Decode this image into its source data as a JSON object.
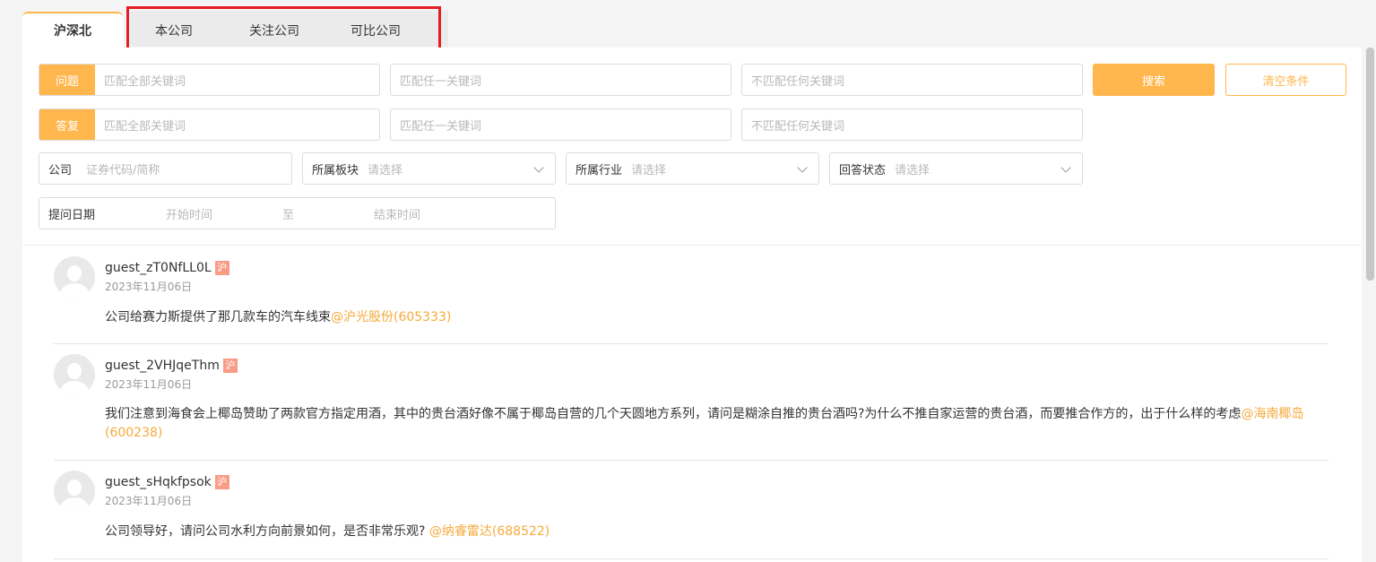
{
  "tabs": {
    "active": "沪深北",
    "group": [
      "本公司",
      "关注公司",
      "可比公司"
    ]
  },
  "search": {
    "question_tag": "问题",
    "answer_tag": "答复",
    "match_all_ph": "匹配全部关键词",
    "match_any_ph": "匹配任一关键词",
    "match_none_ph": "不匹配任何关键词",
    "search_btn": "搜索",
    "clear_btn": "清空条件",
    "company_label": "公司",
    "company_ph": "证券代码/简称",
    "board_label": "所属板块",
    "industry_label": "所属行业",
    "status_label": "回答状态",
    "select_ph": "请选择",
    "date_label": "提问日期",
    "start_ph": "开始时间",
    "to": "至",
    "end_ph": "结束时间"
  },
  "colors": {
    "accent": "#ffb64c",
    "market_badge": "#f89c86",
    "link": "#f6a93b",
    "highlight_border": "#e31e24"
  },
  "questions": [
    {
      "user": "guest_zT0NfLL0L",
      "market": "沪",
      "date": "2023年11月06日",
      "text": "公司给赛力斯提供了那几款车的汽车线束",
      "at": "@沪光股份(605333)"
    },
    {
      "user": "guest_2VHJqeThm",
      "market": "沪",
      "date": "2023年11月06日",
      "text": "我们注意到海食会上椰岛赞助了两款官方指定用酒，其中的贵台酒好像不属于椰岛自营的几个天圆地方系列，请问是糊涂自推的贵台酒吗?为什么不推自家运营的贵台酒，而要推合作方的，出于什么样的考虑",
      "at": "@海南椰岛(600238)"
    },
    {
      "user": "guest_sHqkfpsok",
      "market": "沪",
      "date": "2023年11月06日",
      "text": "公司领导好，请问公司水利方向前景如何，是否非常乐观? ",
      "at": "@纳睿雷达(688522)"
    }
  ]
}
